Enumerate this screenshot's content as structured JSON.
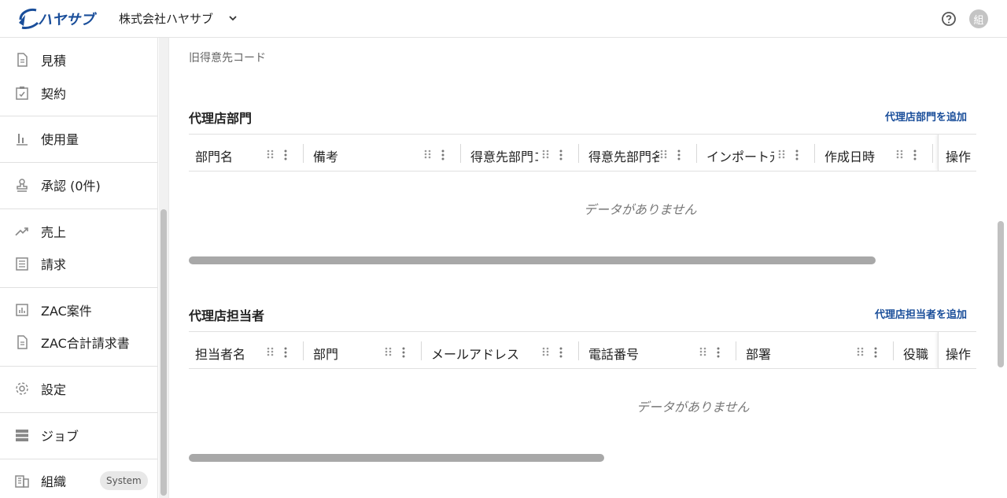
{
  "header": {
    "logo_text": "ハヤサブ",
    "company": "株式会社ハヤサブ",
    "avatar": "組",
    "colors": {
      "brand": "#1a4e9a"
    }
  },
  "sidebar": {
    "items": [
      {
        "label": "見積",
        "icon": "document-icon"
      },
      {
        "label": "契約",
        "icon": "clipboard-check-icon"
      },
      {
        "label": "使用量",
        "icon": "bar-chart-icon"
      },
      {
        "label": "承認 (0件)",
        "icon": "stamp-icon"
      },
      {
        "label": "売上",
        "icon": "trend-up-icon"
      },
      {
        "label": "請求",
        "icon": "list-document-icon"
      },
      {
        "label": "ZAC案件",
        "icon": "chart-box-icon"
      },
      {
        "label": "ZAC合計請求書",
        "icon": "document-icon"
      },
      {
        "label": "設定",
        "icon": "gear-icon"
      },
      {
        "label": "ジョブ",
        "icon": "server-icon"
      },
      {
        "label": "組織",
        "icon": "building-icon",
        "badge": "System"
      }
    ]
  },
  "main": {
    "old_code_label": "旧得意先コード",
    "dept_section": {
      "title": "代理店部門",
      "add_label": "代理店部門を追加",
      "columns": [
        "部門名",
        "備考",
        "得意先部門コード",
        "得意先部門名",
        "インポート元",
        "作成日時"
      ],
      "op_label": "操作",
      "empty": "データがありません"
    },
    "staff_section": {
      "title": "代理店担当者",
      "add_label": "代理店担当者を追加",
      "columns": [
        "担当者名",
        "部門",
        "メールアドレス",
        "電話番号",
        "部署",
        "役職"
      ],
      "op_label": "操作",
      "empty": "データがありません"
    }
  }
}
